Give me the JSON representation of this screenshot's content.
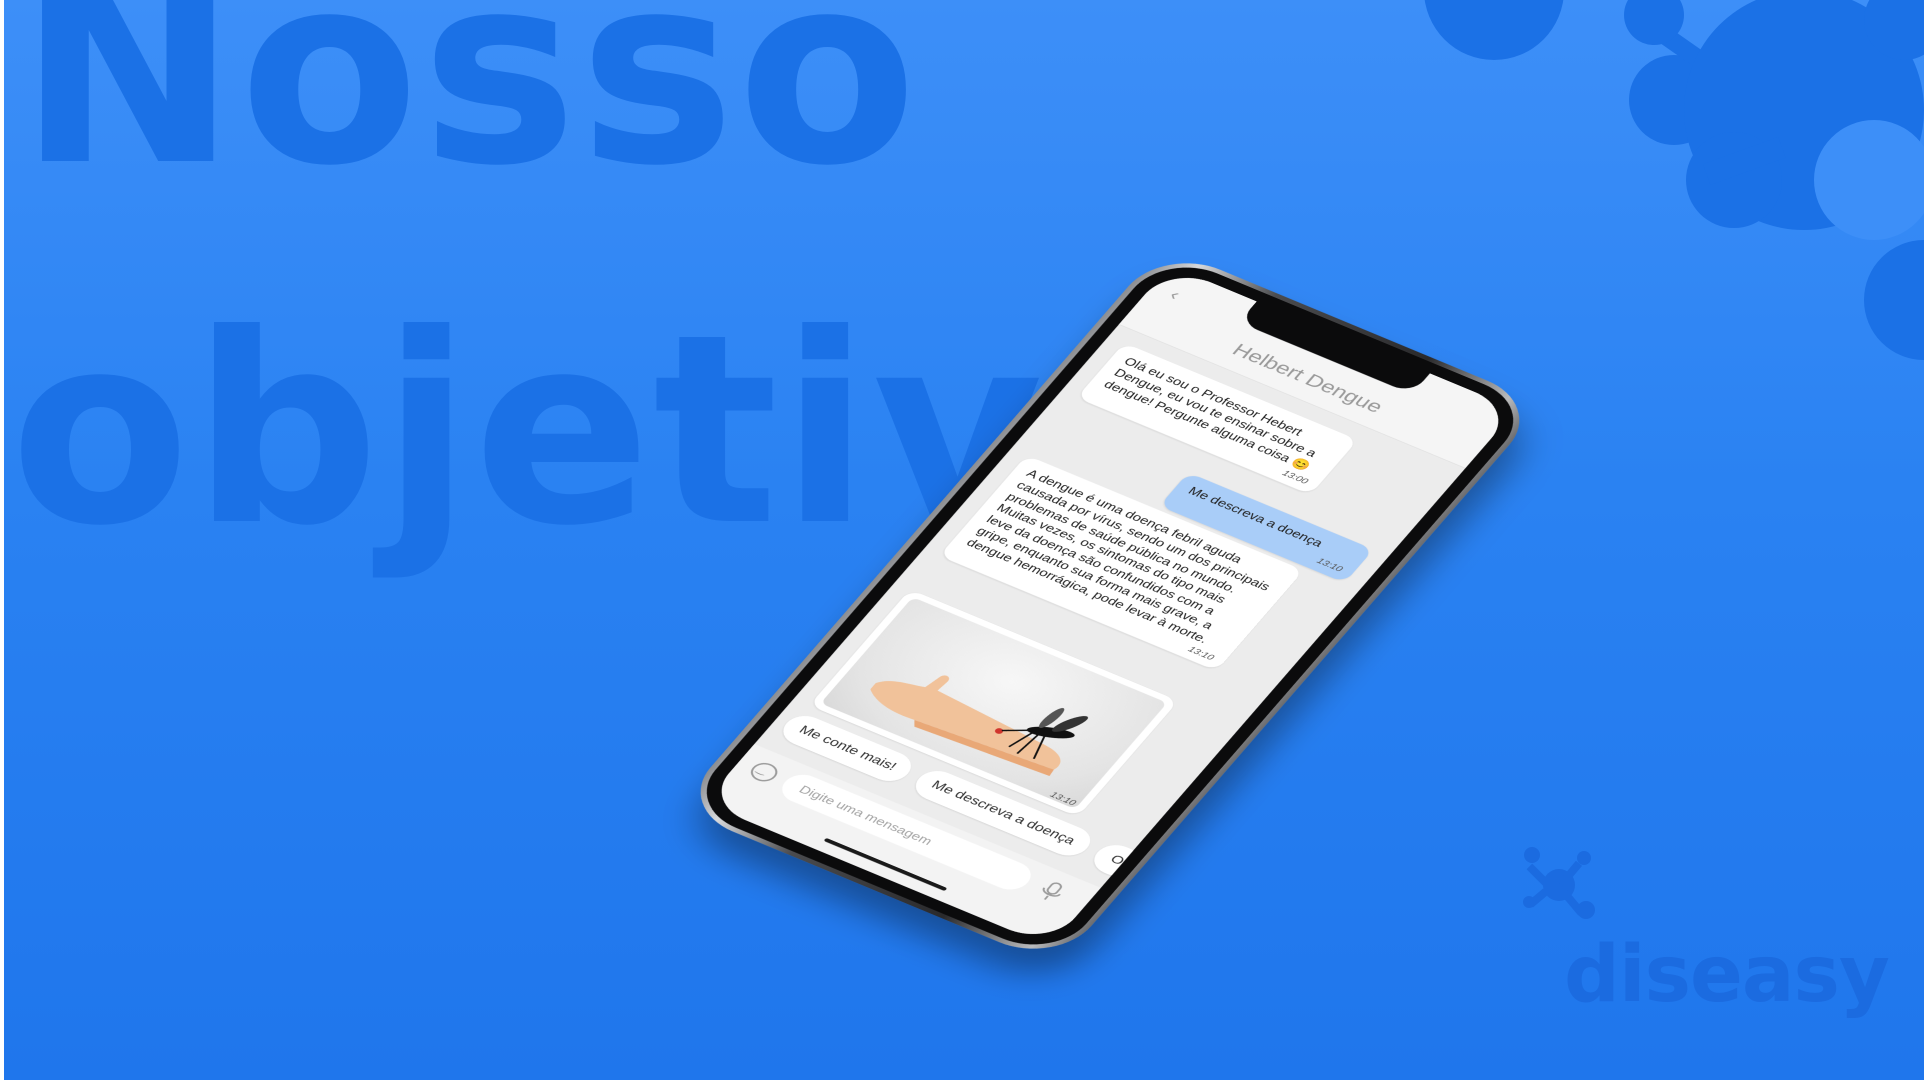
{
  "slide": {
    "title_line1": "Nosso",
    "title_line2": "objetivo",
    "brand_name": "diseasy",
    "colors": {
      "background": "#2a82f2",
      "title_watermark": "#1b71e6",
      "brand": "#1b6be0"
    }
  },
  "chat": {
    "back_icon": "chevron-left-icon",
    "contact_name": "Helbert Dengue",
    "messages": [
      {
        "from": "bot",
        "text": "Olá eu sou o Professor Hebert Dengue, eu vou te ensinar sobre a dengue! Pergunte alguma coisa 😊",
        "time": "13:00"
      },
      {
        "from": "user",
        "text": "Me descreva a doença",
        "time": "13:10"
      },
      {
        "from": "bot",
        "text": "A dengue é uma doença febril aguda causada por vírus, sendo um dos principais problemas de saúde pública no mundo. Muitas vezes, os sintomas do tipo mais leve da doença são confundidos com a gripe, enquanto sua forma mais grave, a dengue hemorrágica, pode levar à morte.",
        "time": "13:10"
      },
      {
        "from": "bot",
        "image": "mosquito-on-arm-illustration",
        "time": "13:10"
      }
    ],
    "quick_replies": [
      "Me conte mais!",
      "Me descreva a doença",
      "O"
    ],
    "composer": {
      "placeholder": "Digite uma mensagem",
      "emoji_icon": "emoji-icon",
      "mic_icon": "microphone-icon"
    },
    "colors": {
      "user_bubble": "#a9cdf8",
      "bot_bubble": "#ffffff",
      "screen_bg": "#ececec"
    }
  }
}
